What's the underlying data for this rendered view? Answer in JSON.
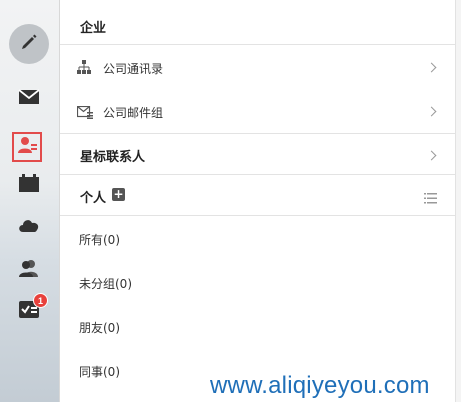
{
  "sidebar": {
    "items": [
      {
        "icon": "pencil-icon",
        "name": "compose"
      },
      {
        "icon": "mail-icon",
        "name": "mail"
      },
      {
        "icon": "contacts-icon",
        "name": "contacts"
      },
      {
        "icon": "calendar-icon",
        "name": "calendar"
      },
      {
        "icon": "cloud-icon",
        "name": "cloud-drive"
      },
      {
        "icon": "users-icon",
        "name": "groups"
      },
      {
        "icon": "task-icon",
        "name": "tasks"
      }
    ],
    "badge": "1",
    "accent_color": "#e24b4b"
  },
  "sections": {
    "enterprise": {
      "title": "企业",
      "items": [
        {
          "label": "公司通讯录",
          "icon": "org-chart-icon"
        },
        {
          "label": "公司邮件组",
          "icon": "mail-group-icon"
        }
      ]
    },
    "starred": {
      "title": "星标联系人"
    },
    "personal": {
      "title": "个人",
      "items": [
        {
          "label": "所有(0)"
        },
        {
          "label": "未分组(0)"
        },
        {
          "label": "朋友(0)"
        },
        {
          "label": "同事(0)"
        }
      ]
    }
  },
  "watermark": "www.aliqiyeyou.com"
}
